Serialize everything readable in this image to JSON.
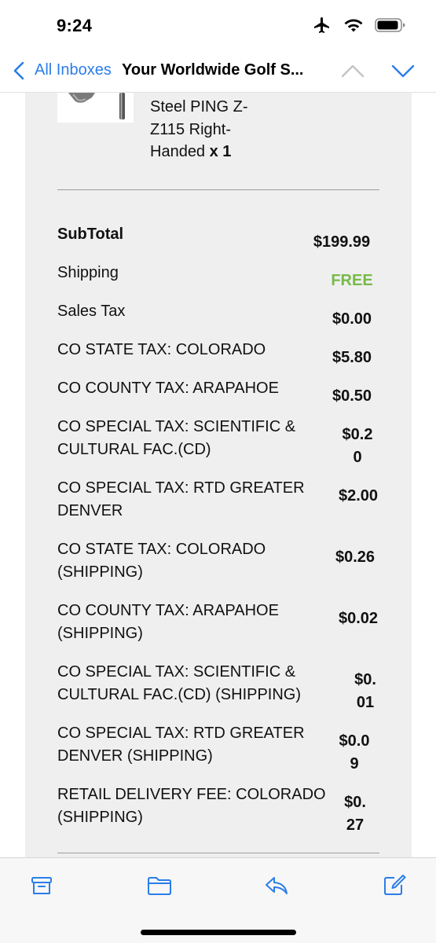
{
  "status_bar": {
    "time": "9:24"
  },
  "nav": {
    "back_label": "All Inboxes",
    "title": "Your Worldwide Golf S..."
  },
  "product": {
    "desc_line1": "Steel PING Z-",
    "desc_line2": "Z115 Right-",
    "desc_line3": "Handed",
    "quantity": "x 1"
  },
  "summary": {
    "subtotal_label": "SubTotal",
    "subtotal_value": "$199.99",
    "rows": [
      {
        "label": "Shipping",
        "value": "FREE"
      },
      {
        "label": "Sales Tax",
        "value": "$0.00"
      },
      {
        "label": "CO STATE TAX: COLORADO",
        "value": "$5.80"
      },
      {
        "label": "CO COUNTY TAX: ARAPAHOE",
        "value": "$0.50"
      },
      {
        "label": "CO SPECIAL TAX: SCIENTIFIC & CULTURAL FAC.(CD)",
        "value": "$0.20"
      },
      {
        "label": "CO SPECIAL TAX: RTD GREATER DENVER",
        "value": "$2.00"
      },
      {
        "label": "CO STATE TAX: COLORADO (SHIPPING)",
        "value": "$0.26"
      },
      {
        "label": "CO COUNTY TAX: ARAPAHOE (SHIPPING)",
        "value": "$0.02"
      },
      {
        "label": "CO SPECIAL TAX: SCIENTIFIC & CULTURAL FAC.(CD) (SHIPPING)",
        "value": "$0.01"
      },
      {
        "label": "CO SPECIAL TAX: RTD GREATER DENVER (SHIPPING)",
        "value": "$0.09"
      },
      {
        "label": "RETAIL DELIVERY FEE: COLORADO (SHIPPING)",
        "value": "$0.27"
      }
    ]
  },
  "toolbar": {
    "icons": [
      "archive-icon",
      "folder-icon",
      "reply-icon",
      "compose-icon"
    ]
  },
  "colors": {
    "accent": "#2b7de9",
    "free": "#78b94a",
    "card_bg": "#efefef"
  }
}
